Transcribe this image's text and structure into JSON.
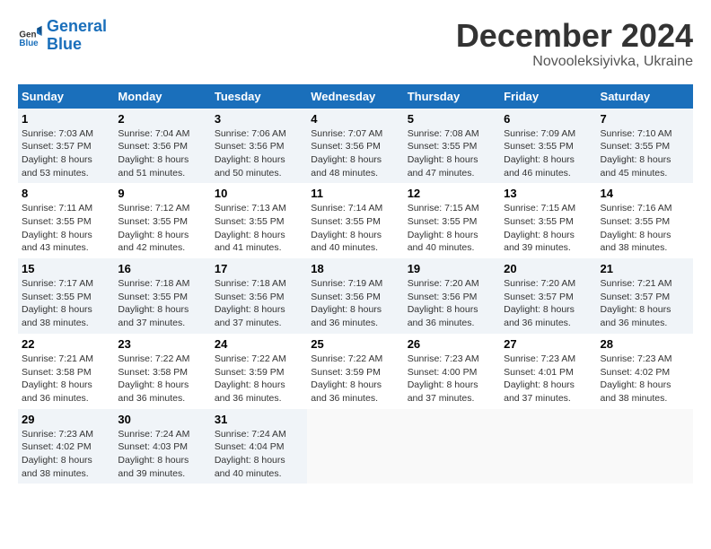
{
  "header": {
    "logo_line1": "General",
    "logo_line2": "Blue",
    "month": "December 2024",
    "location": "Novooleksiyivka, Ukraine"
  },
  "days_of_week": [
    "Sunday",
    "Monday",
    "Tuesday",
    "Wednesday",
    "Thursday",
    "Friday",
    "Saturday"
  ],
  "weeks": [
    [
      {
        "day": "1",
        "info": "Sunrise: 7:03 AM\nSunset: 3:57 PM\nDaylight: 8 hours\nand 53 minutes."
      },
      {
        "day": "2",
        "info": "Sunrise: 7:04 AM\nSunset: 3:56 PM\nDaylight: 8 hours\nand 51 minutes."
      },
      {
        "day": "3",
        "info": "Sunrise: 7:06 AM\nSunset: 3:56 PM\nDaylight: 8 hours\nand 50 minutes."
      },
      {
        "day": "4",
        "info": "Sunrise: 7:07 AM\nSunset: 3:56 PM\nDaylight: 8 hours\nand 48 minutes."
      },
      {
        "day": "5",
        "info": "Sunrise: 7:08 AM\nSunset: 3:55 PM\nDaylight: 8 hours\nand 47 minutes."
      },
      {
        "day": "6",
        "info": "Sunrise: 7:09 AM\nSunset: 3:55 PM\nDaylight: 8 hours\nand 46 minutes."
      },
      {
        "day": "7",
        "info": "Sunrise: 7:10 AM\nSunset: 3:55 PM\nDaylight: 8 hours\nand 45 minutes."
      }
    ],
    [
      {
        "day": "8",
        "info": "Sunrise: 7:11 AM\nSunset: 3:55 PM\nDaylight: 8 hours\nand 43 minutes."
      },
      {
        "day": "9",
        "info": "Sunrise: 7:12 AM\nSunset: 3:55 PM\nDaylight: 8 hours\nand 42 minutes."
      },
      {
        "day": "10",
        "info": "Sunrise: 7:13 AM\nSunset: 3:55 PM\nDaylight: 8 hours\nand 41 minutes."
      },
      {
        "day": "11",
        "info": "Sunrise: 7:14 AM\nSunset: 3:55 PM\nDaylight: 8 hours\nand 40 minutes."
      },
      {
        "day": "12",
        "info": "Sunrise: 7:15 AM\nSunset: 3:55 PM\nDaylight: 8 hours\nand 40 minutes."
      },
      {
        "day": "13",
        "info": "Sunrise: 7:15 AM\nSunset: 3:55 PM\nDaylight: 8 hours\nand 39 minutes."
      },
      {
        "day": "14",
        "info": "Sunrise: 7:16 AM\nSunset: 3:55 PM\nDaylight: 8 hours\nand 38 minutes."
      }
    ],
    [
      {
        "day": "15",
        "info": "Sunrise: 7:17 AM\nSunset: 3:55 PM\nDaylight: 8 hours\nand 38 minutes."
      },
      {
        "day": "16",
        "info": "Sunrise: 7:18 AM\nSunset: 3:55 PM\nDaylight: 8 hours\nand 37 minutes."
      },
      {
        "day": "17",
        "info": "Sunrise: 7:18 AM\nSunset: 3:56 PM\nDaylight: 8 hours\nand 37 minutes."
      },
      {
        "day": "18",
        "info": "Sunrise: 7:19 AM\nSunset: 3:56 PM\nDaylight: 8 hours\nand 36 minutes."
      },
      {
        "day": "19",
        "info": "Sunrise: 7:20 AM\nSunset: 3:56 PM\nDaylight: 8 hours\nand 36 minutes."
      },
      {
        "day": "20",
        "info": "Sunrise: 7:20 AM\nSunset: 3:57 PM\nDaylight: 8 hours\nand 36 minutes."
      },
      {
        "day": "21",
        "info": "Sunrise: 7:21 AM\nSunset: 3:57 PM\nDaylight: 8 hours\nand 36 minutes."
      }
    ],
    [
      {
        "day": "22",
        "info": "Sunrise: 7:21 AM\nSunset: 3:58 PM\nDaylight: 8 hours\nand 36 minutes."
      },
      {
        "day": "23",
        "info": "Sunrise: 7:22 AM\nSunset: 3:58 PM\nDaylight: 8 hours\nand 36 minutes."
      },
      {
        "day": "24",
        "info": "Sunrise: 7:22 AM\nSunset: 3:59 PM\nDaylight: 8 hours\nand 36 minutes."
      },
      {
        "day": "25",
        "info": "Sunrise: 7:22 AM\nSunset: 3:59 PM\nDaylight: 8 hours\nand 36 minutes."
      },
      {
        "day": "26",
        "info": "Sunrise: 7:23 AM\nSunset: 4:00 PM\nDaylight: 8 hours\nand 37 minutes."
      },
      {
        "day": "27",
        "info": "Sunrise: 7:23 AM\nSunset: 4:01 PM\nDaylight: 8 hours\nand 37 minutes."
      },
      {
        "day": "28",
        "info": "Sunrise: 7:23 AM\nSunset: 4:02 PM\nDaylight: 8 hours\nand 38 minutes."
      }
    ],
    [
      {
        "day": "29",
        "info": "Sunrise: 7:23 AM\nSunset: 4:02 PM\nDaylight: 8 hours\nand 38 minutes."
      },
      {
        "day": "30",
        "info": "Sunrise: 7:24 AM\nSunset: 4:03 PM\nDaylight: 8 hours\nand 39 minutes."
      },
      {
        "day": "31",
        "info": "Sunrise: 7:24 AM\nSunset: 4:04 PM\nDaylight: 8 hours\nand 40 minutes."
      },
      {
        "day": "",
        "info": ""
      },
      {
        "day": "",
        "info": ""
      },
      {
        "day": "",
        "info": ""
      },
      {
        "day": "",
        "info": ""
      }
    ]
  ]
}
